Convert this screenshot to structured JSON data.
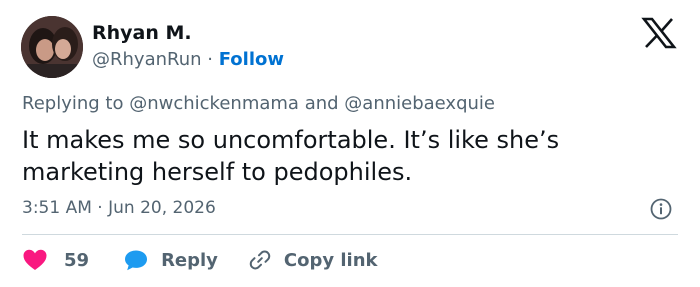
{
  "author": {
    "name": "Rhyan M.",
    "handle": "@RhyanRun",
    "separator": "·",
    "follow_label": "Follow"
  },
  "reply_context": {
    "prefix": "Replying to",
    "mention1": "@nwchickenmama",
    "conjunction": "and",
    "mention2": "@anniebaexquie"
  },
  "tweet": {
    "line1": "It makes me so uncomfortable. It’s like she’s",
    "line2": "marketing herself to pedophiles."
  },
  "meta": {
    "time": "3:51 AM",
    "separator": "·",
    "date": "Jun 20, 2026"
  },
  "actions": {
    "like_count": "59",
    "reply_label": "Reply",
    "copy_link_label": "Copy link"
  },
  "colors": {
    "like": "#f91880",
    "reply": "#1d9bf0",
    "follow": "#0072d2",
    "muted": "#536471"
  },
  "icons": {
    "logo": "x-logo-icon",
    "info": "info-icon",
    "like": "heart-icon",
    "reply": "chat-bubble-icon",
    "copy": "link-icon"
  }
}
